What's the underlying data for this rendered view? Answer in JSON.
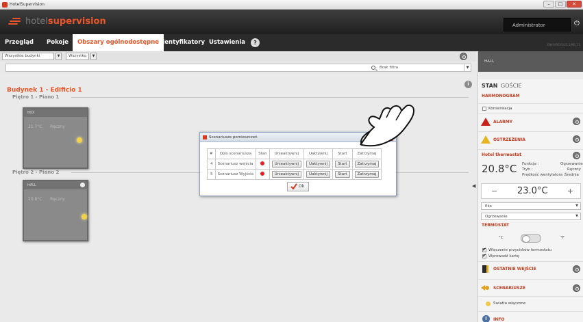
{
  "window": {
    "title": "HotelSupervision",
    "min": "–",
    "max": "□",
    "close": "✕"
  },
  "header": {
    "logo_light": "hotel",
    "logo_bold": "supervision",
    "user": "Administrator"
  },
  "nav": {
    "tabs": [
      "Przegląd",
      "Pokoje",
      "Obszary ogólnodostępne",
      "Identyfikatory",
      "Ustawienia"
    ],
    "active_index": 2,
    "help": "?",
    "version_note": "ENKO/REV5/V5.5/MB_15"
  },
  "filters": {
    "building": "Wszystkie budynki",
    "scope": "Wszystko",
    "arrow": "▼",
    "search_placeholder": "Brak filtra"
  },
  "main": {
    "building_title": "Budynek 1 - Edificio 1",
    "floors": [
      {
        "title": "Piętro 1 - Piano 1",
        "room": {
          "name": "BOX",
          "temp": "21.7°C",
          "mode": "Ręczny"
        }
      },
      {
        "title": "Piętro 2 - Piano 2",
        "room": {
          "name": "HALL",
          "temp": "20.8°C",
          "mode": "Ręczny"
        }
      }
    ],
    "info": "i"
  },
  "dialog": {
    "title": "Scenariusze pomieszczeń",
    "close": "✕",
    "headers": [
      "#",
      "Opis scenariusza",
      "Stan",
      "Unieaktywnij",
      "Uaktywnij",
      "Start",
      "Zatrzymaj"
    ],
    "rows": [
      {
        "num": "4",
        "name": "Scenariusz wejścia",
        "deactivate": "Unieaktywnij",
        "activate": "Uaktywnij",
        "start": "Start",
        "stop": "Zatrzymaj"
      },
      {
        "num": "5",
        "name": "Scenariusz Wyjścia",
        "deactivate": "Unieaktywnij",
        "activate": "Uaktywnij",
        "start": "Start",
        "stop": "Zatrzymaj"
      }
    ],
    "ok": "Ok"
  },
  "sidebar": {
    "room": "HALL",
    "tab_state": "STAN",
    "tab_guests": "GOŚCIE",
    "schedule": "HARMONOGRAM",
    "maintenance": "Konserwacja",
    "alarms": "ALARMY",
    "warnings": "OSTRZEŻENIA",
    "thermostat_title": "Hotel thermostat",
    "temp_current": "20.8°C",
    "function_label": "Funkcja :",
    "function_value": "Ogrzewanie",
    "mode_label": "Tryb :",
    "mode_value": "Ręczny",
    "fan_label": "Prędkość wentylatora :",
    "fan_value": "Średnia",
    "minus": "−",
    "plus": "+",
    "setpoint": "23.0°C",
    "eco": "Eko",
    "heating": "Ogrzewanie",
    "thermostat_section": "TERMOSTAT",
    "unit_c": "°C",
    "unit_f": "°F",
    "buttons_enabled": "Włączenie przycisków termostatu",
    "insert_card": "Wprowadź kartę",
    "last_entries": "OSTATNIE WEJŚCIE",
    "scenarios": "SCENARIUSZE",
    "lights_on": "Światła włączone",
    "info": "INFO",
    "collapse": "◀"
  }
}
